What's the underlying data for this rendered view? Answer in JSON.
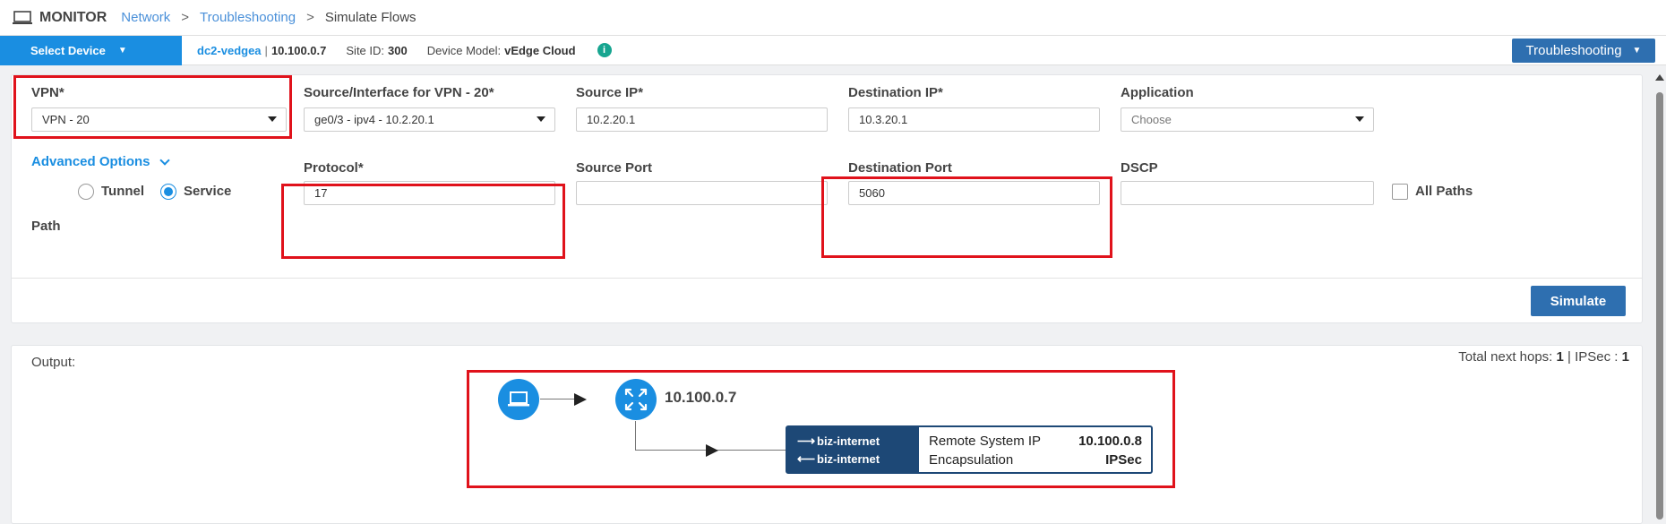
{
  "header": {
    "title": "MONITOR",
    "breadcrumb": [
      "Network",
      "Troubleshooting"
    ],
    "current": "Simulate Flows",
    "separator": ">"
  },
  "device_bar": {
    "select_label": "Select Device",
    "hostname": "dc2-vedgea",
    "separator": "|",
    "system_ip": "10.100.0.7",
    "site_label": "Site ID:",
    "site_value": "300",
    "model_label": "Device Model:",
    "model_value": "vEdge Cloud",
    "info_icon": "i",
    "troubleshooting_label": "Troubleshooting"
  },
  "form": {
    "vpn": {
      "label": "VPN*",
      "value": "VPN - 20"
    },
    "source_interface": {
      "label": "Source/Interface for VPN - 20*",
      "value": "ge0/3 - ipv4 - 10.2.20.1"
    },
    "source_ip": {
      "label": "Source IP*",
      "value": "10.2.20.1"
    },
    "destination_ip": {
      "label": "Destination IP*",
      "value": "10.3.20.1"
    },
    "application": {
      "label": "Application",
      "placeholder": "Choose"
    },
    "advanced_options_label": "Advanced Options",
    "path": {
      "label": "Path",
      "options": [
        "Tunnel",
        "Service"
      ],
      "selected": "Service"
    },
    "protocol": {
      "label": "Protocol*",
      "value": "17"
    },
    "source_port": {
      "label": "Source Port",
      "value": ""
    },
    "destination_port": {
      "label": "Destination Port",
      "value": "5060"
    },
    "dscp": {
      "label": "DSCP",
      "value": ""
    },
    "all_paths": {
      "label": "All Paths",
      "checked": false
    },
    "simulate_label": "Simulate"
  },
  "output": {
    "label": "Output:",
    "hops_label": "Total next hops:",
    "hops_value": "1",
    "hops_sep": "|",
    "ipsec_label": "IPSec :",
    "ipsec_value": "1",
    "node_ip": "10.100.0.7",
    "tunnel": {
      "local_color": "biz-internet",
      "remote_color": "biz-internet",
      "remote_system_ip_label": "Remote System IP",
      "remote_system_ip": "10.100.0.8",
      "encapsulation_label": "Encapsulation",
      "encapsulation": "IPSec"
    }
  },
  "colors": {
    "accent": "#1a8ee1",
    "button": "#2e6fb0",
    "highlight": "#e0121b",
    "tunnel": "#1d4876"
  },
  "icons": [
    "laptop-icon",
    "router-icon",
    "info-icon",
    "chevron-down-icon",
    "arrow-right-icon",
    "arrow-left-icon"
  ]
}
